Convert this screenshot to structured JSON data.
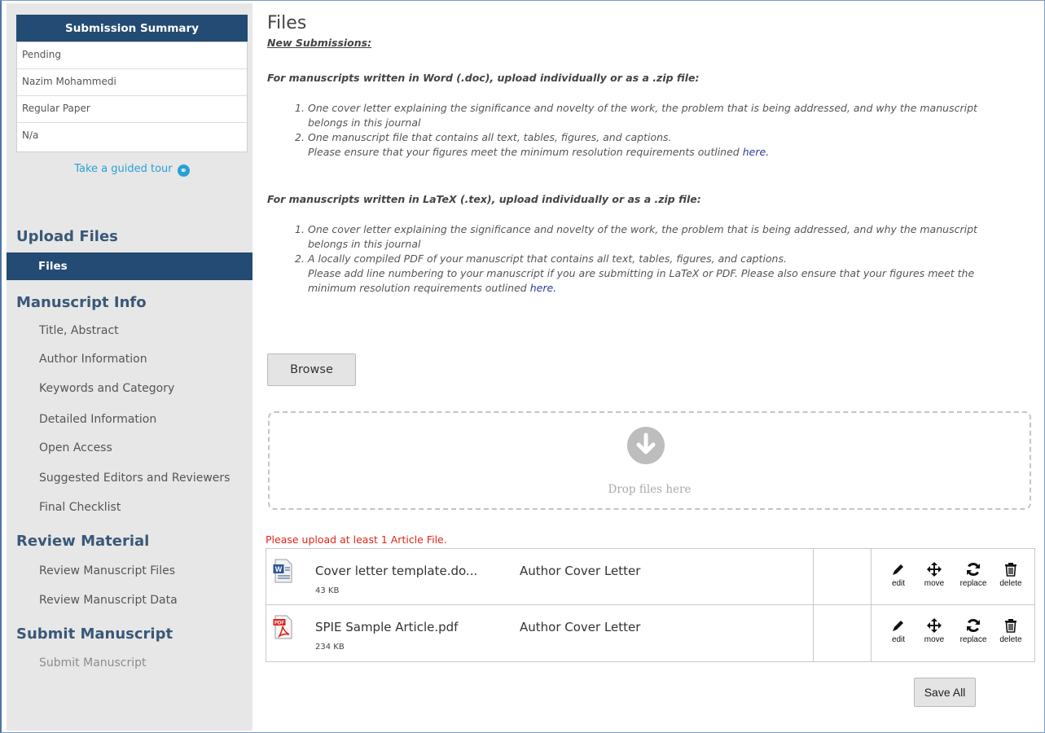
{
  "sidebar": {
    "summary_title": "Submission Summary",
    "summary_rows": [
      "Pending",
      "Nazim Mohammedi",
      "Regular Paper",
      "N/a"
    ],
    "tour_link": "Take a guided tour",
    "sections": [
      {
        "heading": "Upload Files",
        "items": [
          "Files"
        ]
      },
      {
        "heading": "Manuscript Info",
        "items": [
          "Title, Abstract",
          "Author Information",
          "Keywords and Category",
          "Detailed Information",
          "Open Access",
          "Suggested Editors and Reviewers",
          "Final Checklist"
        ]
      },
      {
        "heading": "Review Material",
        "items": [
          "Review Manuscript Files",
          "Review Manuscript Data"
        ]
      },
      {
        "heading": "Submit Manuscript",
        "items": [
          "Submit Manuscript"
        ]
      }
    ],
    "active_item": "Files",
    "accent_color": "#234b73"
  },
  "main": {
    "title": "Files",
    "new_submissions": "New Submissions:",
    "word_heading": "For manuscripts written in Word (.doc), upload individually or as a .zip file:",
    "word_items": [
      {
        "num": "1.",
        "line1": "One cover letter explaining the significance and novelty of the work, the problem that is being addressed, and why the manuscript",
        "line2": "belongs in this journal"
      },
      {
        "num": "2.",
        "line1": "One manuscript file that contains all text, tables, figures, and captions.",
        "line2": "Please ensure that your figures meet the minimum resolution requirements outlined ",
        "link": "here."
      }
    ],
    "latex_heading": "For manuscripts written in LaTeX (.tex), upload individually or as a .zip file:",
    "latex_items": [
      {
        "num": "1.",
        "line1": "One cover letter explaining the significance and novelty of the work, the problem that is being addressed, and why the manuscript",
        "line2": "belongs in this journal"
      },
      {
        "num": "2.",
        "line1": "A locally compiled PDF of your manuscript that contains all text, tables, figures, and captions.",
        "line2": "Please add line numbering to your manuscript if you are submitting in LaTeX or PDF. Please also ensure that your figures meet the",
        "line3": "minimum resolution requirements outlined ",
        "link": "here."
      }
    ],
    "browse_label": "Browse",
    "drop_text": "Drop files here",
    "error": "Please upload at least 1 Article File.",
    "files": [
      {
        "name": "Cover letter template.do...",
        "size": "43 KB",
        "type": "Author Cover Letter",
        "icon": "word-doc-icon"
      },
      {
        "name": "SPIE Sample Article.pdf",
        "size": "234 KB",
        "type": "Author Cover Letter",
        "icon": "pdf-icon"
      }
    ],
    "actions": {
      "edit": "edit",
      "move": "move",
      "replace": "replace",
      "delete": "delete"
    },
    "save_label": "Save All",
    "error_color": "#e0261b"
  }
}
